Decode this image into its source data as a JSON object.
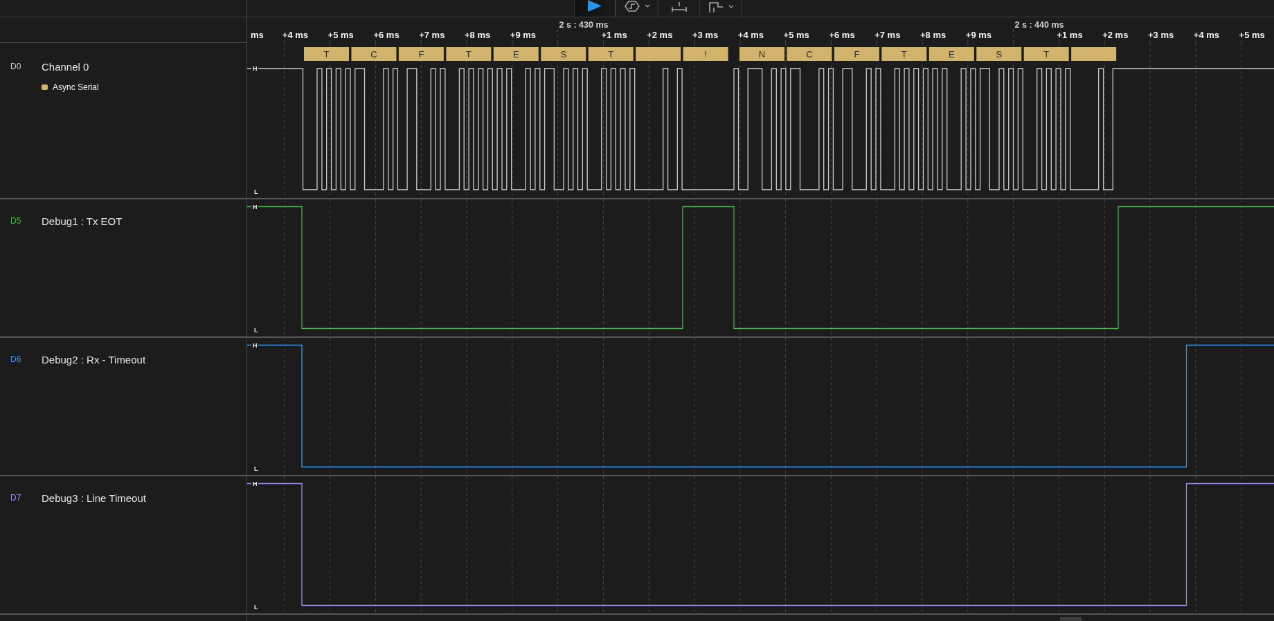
{
  "toolbar": {
    "buttons": [
      {
        "kind": "play",
        "dropdown": false
      },
      {
        "kind": "trigger",
        "dropdown": true
      },
      {
        "kind": "measure",
        "dropdown": false
      },
      {
        "kind": "marker",
        "dropdown": true
      }
    ]
  },
  "timeline": {
    "ticks": [
      {
        "kind": "minor",
        "label": "ms"
      },
      {
        "kind": "minor",
        "label": "+4 ms"
      },
      {
        "kind": "minor",
        "label": "+5 ms"
      },
      {
        "kind": "minor",
        "label": "+6 ms"
      },
      {
        "kind": "minor",
        "label": "+7 ms"
      },
      {
        "kind": "minor",
        "label": "+8 ms"
      },
      {
        "kind": "minor",
        "label": "+9 ms"
      },
      {
        "kind": "major",
        "label": "2 s : 430 ms"
      },
      {
        "kind": "minor",
        "label": "+1 ms"
      },
      {
        "kind": "minor",
        "label": "+2 ms"
      },
      {
        "kind": "minor",
        "label": "+3 ms"
      },
      {
        "kind": "minor",
        "label": "+4 ms"
      },
      {
        "kind": "minor",
        "label": "+5 ms"
      },
      {
        "kind": "minor",
        "label": "+6 ms"
      },
      {
        "kind": "minor",
        "label": "+7 ms"
      },
      {
        "kind": "minor",
        "label": "+8 ms"
      },
      {
        "kind": "minor",
        "label": "+9 ms"
      },
      {
        "kind": "major",
        "label": "2 s : 440 ms"
      },
      {
        "kind": "minor",
        "label": "+1 ms"
      },
      {
        "kind": "minor",
        "label": "+2 ms"
      },
      {
        "kind": "minor",
        "label": "+3 ms"
      },
      {
        "kind": "minor",
        "label": "+4 ms"
      },
      {
        "kind": "minor",
        "label": "+5 ms"
      }
    ]
  },
  "channels": [
    {
      "id": "D0",
      "name": "Channel 0",
      "color": "#cccccc",
      "high_label": "H",
      "low_label": "L",
      "analyzer": {
        "name": "Async Serial",
        "color": "#d2b36c",
        "frames": [
          {
            "kind": "char",
            "label": "T"
          },
          {
            "kind": "char",
            "label": "C"
          },
          {
            "kind": "char",
            "label": "F"
          },
          {
            "kind": "char",
            "label": "T"
          },
          {
            "kind": "char",
            "label": "E"
          },
          {
            "kind": "char",
            "label": "S"
          },
          {
            "kind": "char",
            "label": "T"
          },
          {
            "kind": "blank"
          },
          {
            "kind": "char",
            "label": "!"
          },
          {
            "kind": "char",
            "label": "N"
          },
          {
            "kind": "char",
            "label": "C"
          },
          {
            "kind": "char",
            "label": "F"
          },
          {
            "kind": "char",
            "label": "T"
          },
          {
            "kind": "char",
            "label": "E"
          },
          {
            "kind": "char",
            "label": "S"
          },
          {
            "kind": "char",
            "label": "T"
          },
          {
            "kind": "blank"
          }
        ]
      }
    },
    {
      "id": "D5",
      "name": "Debug1 : Tx EOT",
      "color": "#4caf50",
      "high_label": "H",
      "low_label": "L"
    },
    {
      "id": "D6",
      "name": "Debug2 : Rx - Timeout",
      "color": "#3d9be9",
      "high_label": "H",
      "low_label": "L"
    },
    {
      "id": "D7",
      "name": "Debug3 : Line Timeout",
      "color": "#a48cf0",
      "high_label": "H",
      "low_label": "L"
    }
  ]
}
